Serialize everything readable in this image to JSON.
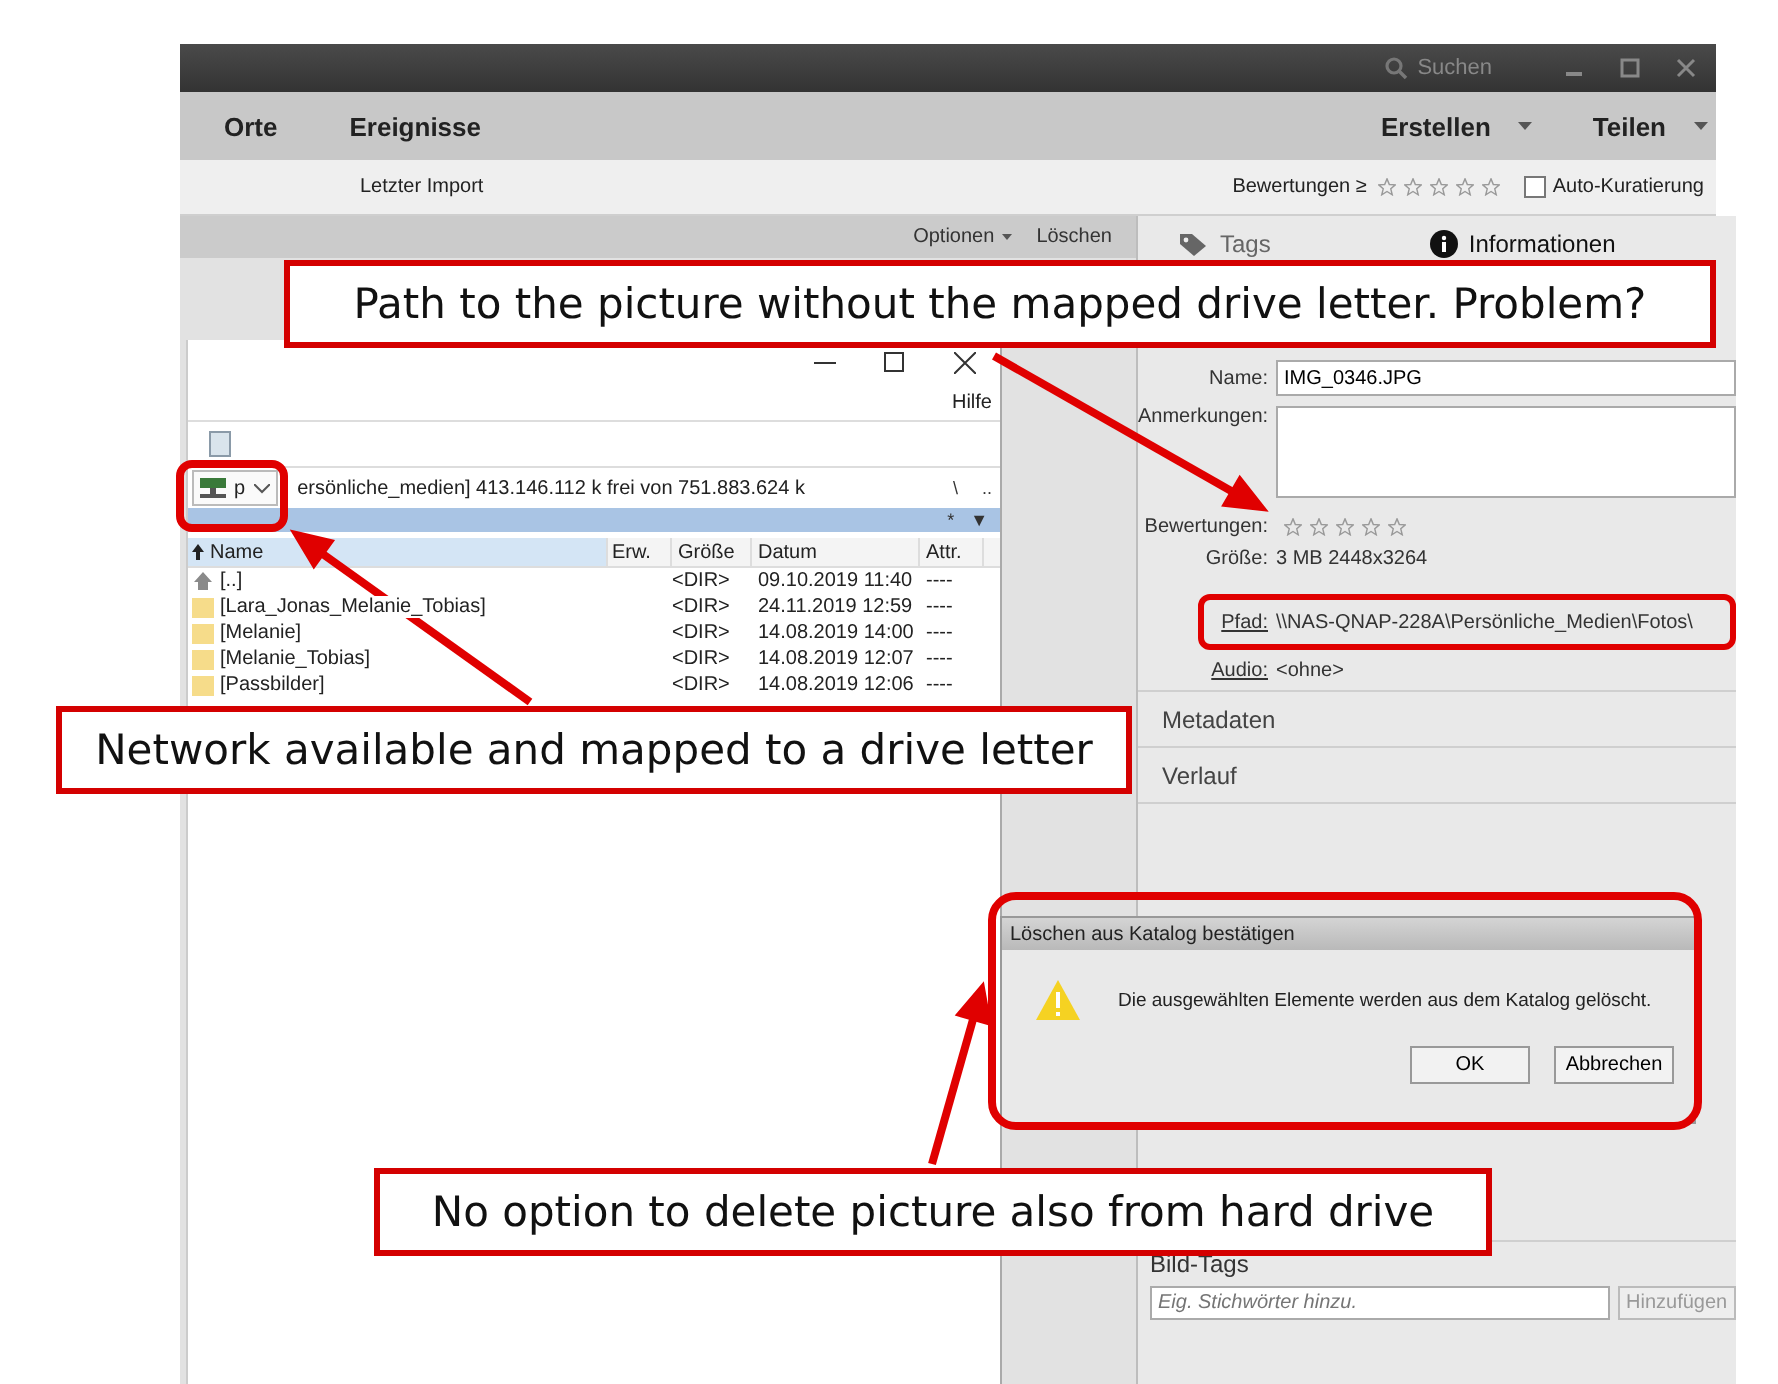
{
  "app": {
    "search_placeholder": "Suchen",
    "nav": [
      {
        "label": "Orte"
      },
      {
        "label": "Ereignisse"
      }
    ],
    "menus": [
      {
        "label": "Erstellen"
      },
      {
        "label": "Teilen"
      }
    ],
    "filter": "Letzter Import",
    "rating_filter": {
      "label": "Bewertungen ≥",
      "stars": 0
    },
    "auto_curation": {
      "label": "Auto-Kuratierung",
      "checked": false
    },
    "toolbar": [
      {
        "label": "Optionen",
        "dropdown": true
      },
      {
        "label": "Löschen",
        "dropdown": false
      }
    ],
    "panel_tabs": [
      {
        "label": "Tags",
        "kind": "tag",
        "selected": false
      },
      {
        "label": "Informationen",
        "kind": "info",
        "selected": true
      }
    ],
    "info": {
      "name_label": "Name:",
      "name": "IMG_0346.JPG",
      "notes_label": "Anmerkungen:",
      "rating_label": "Bewertungen:",
      "stars": 0,
      "size_label": "Größe:",
      "size": "3 MB  2448x3264",
      "path_label": "Pfad:",
      "path": "\\\\NAS-QNAP-228A\\Persönliche_Medien\\Fotos\\",
      "audio_label": "Audio:",
      "audio": "<ohne>"
    },
    "sections": [
      {
        "label": "Metadaten"
      },
      {
        "label": "Verlauf"
      }
    ],
    "image_tags": {
      "title": "Bild-Tags",
      "placeholder": "Eig. Stichwörter hinzu.",
      "button": "Hinzufügen"
    }
  },
  "file_manager": {
    "menu": "Hilfe",
    "drive": "p",
    "drive_info": "ersönliche_medien]  413.146.112 k frei von 751.883.624 k",
    "nav_buttons": [
      "\\",
      ".."
    ],
    "filter_buttons": [
      "*",
      "▼"
    ],
    "columns": [
      {
        "label": "Name",
        "sorted": true
      },
      {
        "label": "Erw.",
        "sorted": false
      },
      {
        "label": "Größe",
        "sorted": false
      },
      {
        "label": "Datum",
        "sorted": false
      },
      {
        "label": "Attr.",
        "sorted": false
      }
    ],
    "rows": [
      {
        "kind": "parent",
        "name": "[..]",
        "size": "<DIR>",
        "date": "09.10.2019 11:40",
        "attr": "----"
      },
      {
        "kind": "folder",
        "name": "[Lara_Jonas_Melanie_Tobias]",
        "size": "<DIR>",
        "date": "24.11.2019 12:59",
        "attr": "----"
      },
      {
        "kind": "folder",
        "name": "[Melanie]",
        "size": "<DIR>",
        "date": "14.08.2019 14:00",
        "attr": "----"
      },
      {
        "kind": "folder",
        "name": "[Melanie_Tobias]",
        "size": "<DIR>",
        "date": "14.08.2019 12:07",
        "attr": "----"
      },
      {
        "kind": "folder",
        "name": "[Passbilder]",
        "size": "<DIR>",
        "date": "14.08.2019 12:06",
        "attr": "----"
      }
    ]
  },
  "dialog": {
    "title": "Löschen aus Katalog bestätigen",
    "message": "Die ausgewählten Elemente werden aus dem Katalog gelöscht.",
    "buttons": [
      {
        "label": "OK"
      },
      {
        "label": "Abbrechen"
      }
    ]
  },
  "annotations": [
    {
      "text": "Path to the picture without the mapped drive letter. Problem?"
    },
    {
      "text": "Network available and mapped to a drive letter"
    },
    {
      "text": "No option to delete picture also from hard drive"
    }
  ]
}
